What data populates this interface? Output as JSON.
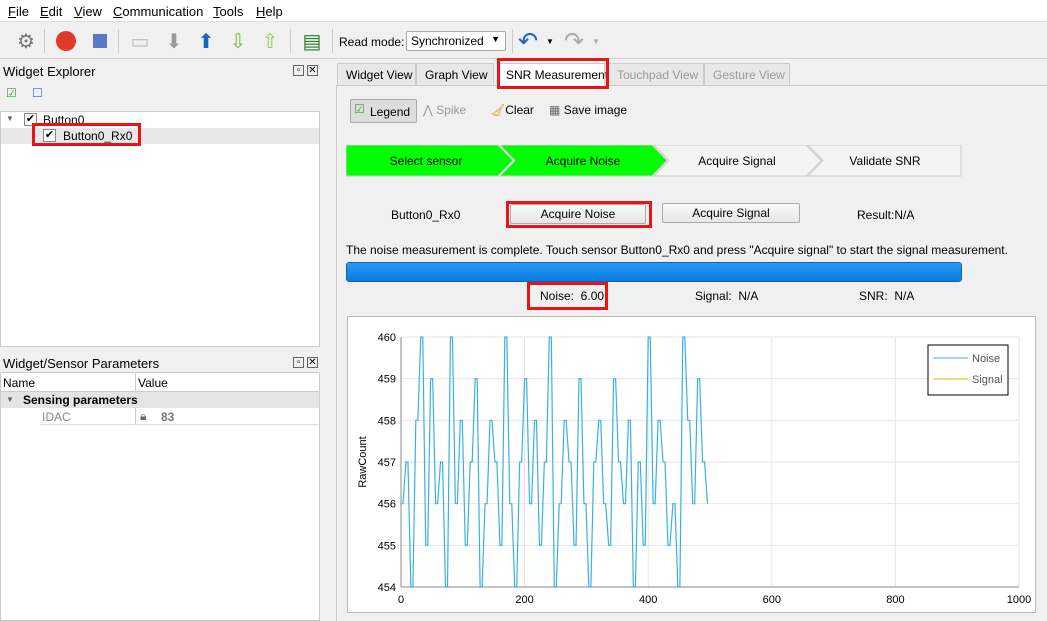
{
  "menu": [
    "File",
    "Edit",
    "View",
    "Communication",
    "Tools",
    "Help"
  ],
  "toolbar": {
    "read_mode_label": "Read mode:",
    "read_mode_value": "Synchronized",
    "icons": [
      "gear-icon",
      "disconnect-icon",
      "stop-icon",
      "open-folder-icon",
      "download-icon",
      "upload-icon",
      "arrow-down-icon",
      "arrow-up-icon",
      "log-icon",
      "undo-icon",
      "redo-icon"
    ]
  },
  "widget_explorer": {
    "title": "Widget Explorer",
    "tree": [
      {
        "label": "Button0",
        "checked": true
      },
      {
        "label": "Button0_Rx0",
        "checked": true,
        "selected": true
      }
    ]
  },
  "params": {
    "title": "Widget/Sensor Parameters",
    "col_name": "Name",
    "col_value": "Value",
    "group": "Sensing parameters",
    "rows": [
      {
        "name": "IDAC",
        "value": "83",
        "locked": true
      }
    ]
  },
  "tabs": [
    {
      "label": "Widget View"
    },
    {
      "label": "Graph View"
    },
    {
      "label": "SNR Measurement",
      "active": true
    },
    {
      "label": "Touchpad View",
      "disabled": true
    },
    {
      "label": "Gesture View",
      "disabled": true
    }
  ],
  "snr": {
    "tools": {
      "legend": "Legend",
      "spike": "Spike",
      "clear": "Clear",
      "save_image": "Save image"
    },
    "steps": [
      {
        "label": "Select sensor",
        "done": true
      },
      {
        "label": "Acquire Noise",
        "done": true
      },
      {
        "label": "Acquire Signal",
        "done": false
      },
      {
        "label": "Validate SNR",
        "done": false
      }
    ],
    "sensor": "Button0_Rx0",
    "acquire_noise": "Acquire Noise",
    "acquire_signal": "Acquire Signal",
    "result": "Result:N/A",
    "message": "The noise measurement is complete. Touch sensor Button0_Rx0 and press \"Acquire signal\" to start the signal measurement.",
    "progress_percent": 100,
    "noise": "Noise:  6.00",
    "signal": "Signal:  N/A",
    "snr_value": "SNR:  N/A"
  },
  "colors": {
    "step_done": "#00ff00",
    "progress": "#0a84e8",
    "noise": "#3bb0e0",
    "signal": "#e8b400",
    "highlight": "#e8141c"
  },
  "chart_data": {
    "type": "line",
    "ylabel": "RawCount",
    "xlim": [
      0,
      1000
    ],
    "ylim": [
      454,
      460
    ],
    "xticks": [
      "0",
      "200",
      "400",
      "600",
      "800",
      "1000"
    ],
    "yticks": [
      "454",
      "455",
      "456",
      "457",
      "458",
      "459",
      "460"
    ],
    "grid": true,
    "legend_position": "top-right",
    "series": [
      {
        "name": "Noise",
        "x": [
          0,
          8,
          16,
          24,
          32,
          40,
          48,
          56,
          64,
          72,
          80,
          88,
          96,
          104,
          112,
          120,
          128,
          136,
          144,
          152,
          160,
          168,
          176,
          184,
          192,
          200,
          208,
          216,
          224,
          232,
          240,
          248,
          256,
          264,
          272,
          280,
          288,
          296,
          304,
          312,
          320,
          328,
          336,
          344,
          352,
          360,
          368,
          376,
          384,
          392,
          400,
          408,
          416,
          424,
          432,
          440,
          448,
          456,
          464,
          472,
          480,
          488,
          496
        ],
        "y": [
          456,
          457,
          454,
          458,
          460,
          455,
          459,
          456,
          457,
          454,
          460,
          456,
          458,
          455,
          457,
          459,
          454,
          456,
          458,
          457,
          455,
          460,
          456,
          454,
          457,
          459,
          456,
          458,
          455,
          457,
          460,
          454,
          456,
          458,
          457,
          455,
          459,
          456,
          454,
          457,
          458,
          456,
          455,
          459,
          457,
          456,
          458,
          454,
          457,
          455,
          460,
          456,
          458,
          457,
          455,
          456,
          454,
          460,
          458,
          456,
          459,
          457,
          456
        ]
      },
      {
        "name": "Signal",
        "x": [],
        "y": []
      }
    ]
  }
}
